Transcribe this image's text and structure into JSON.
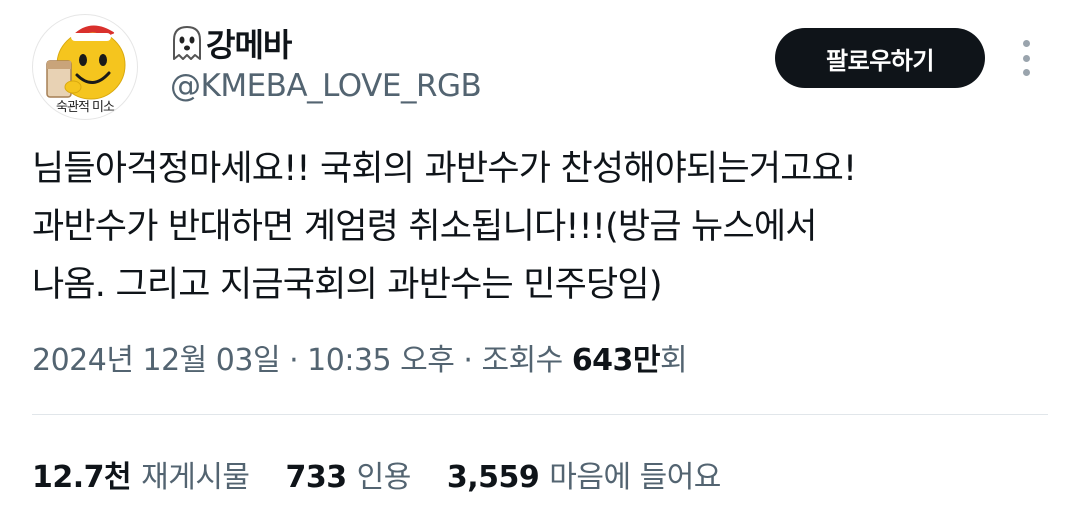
{
  "user": {
    "display_name": "강메바",
    "handle": "@KMEBA_LOVE_RGB",
    "avatar_caption": "숙관적 미소",
    "name_icon": "ghost-icon"
  },
  "header": {
    "follow_label": "팔로우하기",
    "more_icon": "more-vertical-icon"
  },
  "tweet": {
    "lines": [
      "님들아걱정마세요!! 국회의 과반수가 찬성해야되는거고요!",
      "과반수가 반대하면 계엄령 취소됩니다!!!(방금 뉴스에서",
      "나옴. 그리고 지금국회의 과반수는 민주당임)"
    ]
  },
  "meta": {
    "timestamp": "2024년 12월 03일 · 10:35 오후 · 조회수 ",
    "views_number": "643만",
    "views_suffix": "회"
  },
  "stats": {
    "retweets_value": "12.7천",
    "retweets_label": "재게시물",
    "quotes_value": "733",
    "quotes_label": "인용",
    "likes_value": "3,559",
    "likes_label": "마음에 들어요"
  },
  "colors": {
    "text_primary": "#0f1419",
    "text_secondary": "#536471",
    "follow_button_bg": "#0f1419",
    "avatar_face": "#f5c51e"
  }
}
